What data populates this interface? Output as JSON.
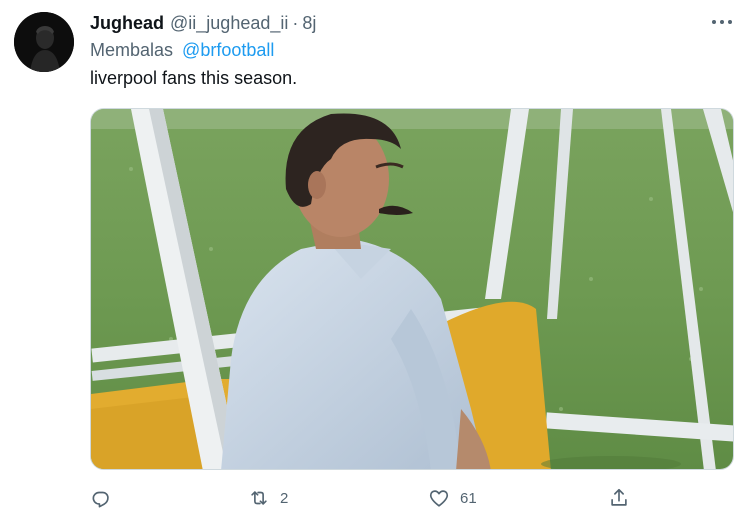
{
  "tweet": {
    "author_name": "Jughead",
    "author_handle": "@ii_jughead_ii",
    "separator": "·",
    "time": "8j",
    "reply_prefix": "Membalas",
    "reply_to": "@brfootball",
    "text": "liverpool fans this season."
  },
  "actions": {
    "reply_count": "",
    "retweet_count": "2",
    "like_count": "61",
    "share_count": ""
  },
  "icons": {
    "more": "more-horizontal-icon",
    "reply": "reply-icon",
    "retweet": "retweet-icon",
    "like": "heart-icon",
    "share": "share-icon"
  },
  "colors": {
    "link": "#1d9bf0",
    "secondary": "#536471",
    "text": "#0f1419"
  }
}
